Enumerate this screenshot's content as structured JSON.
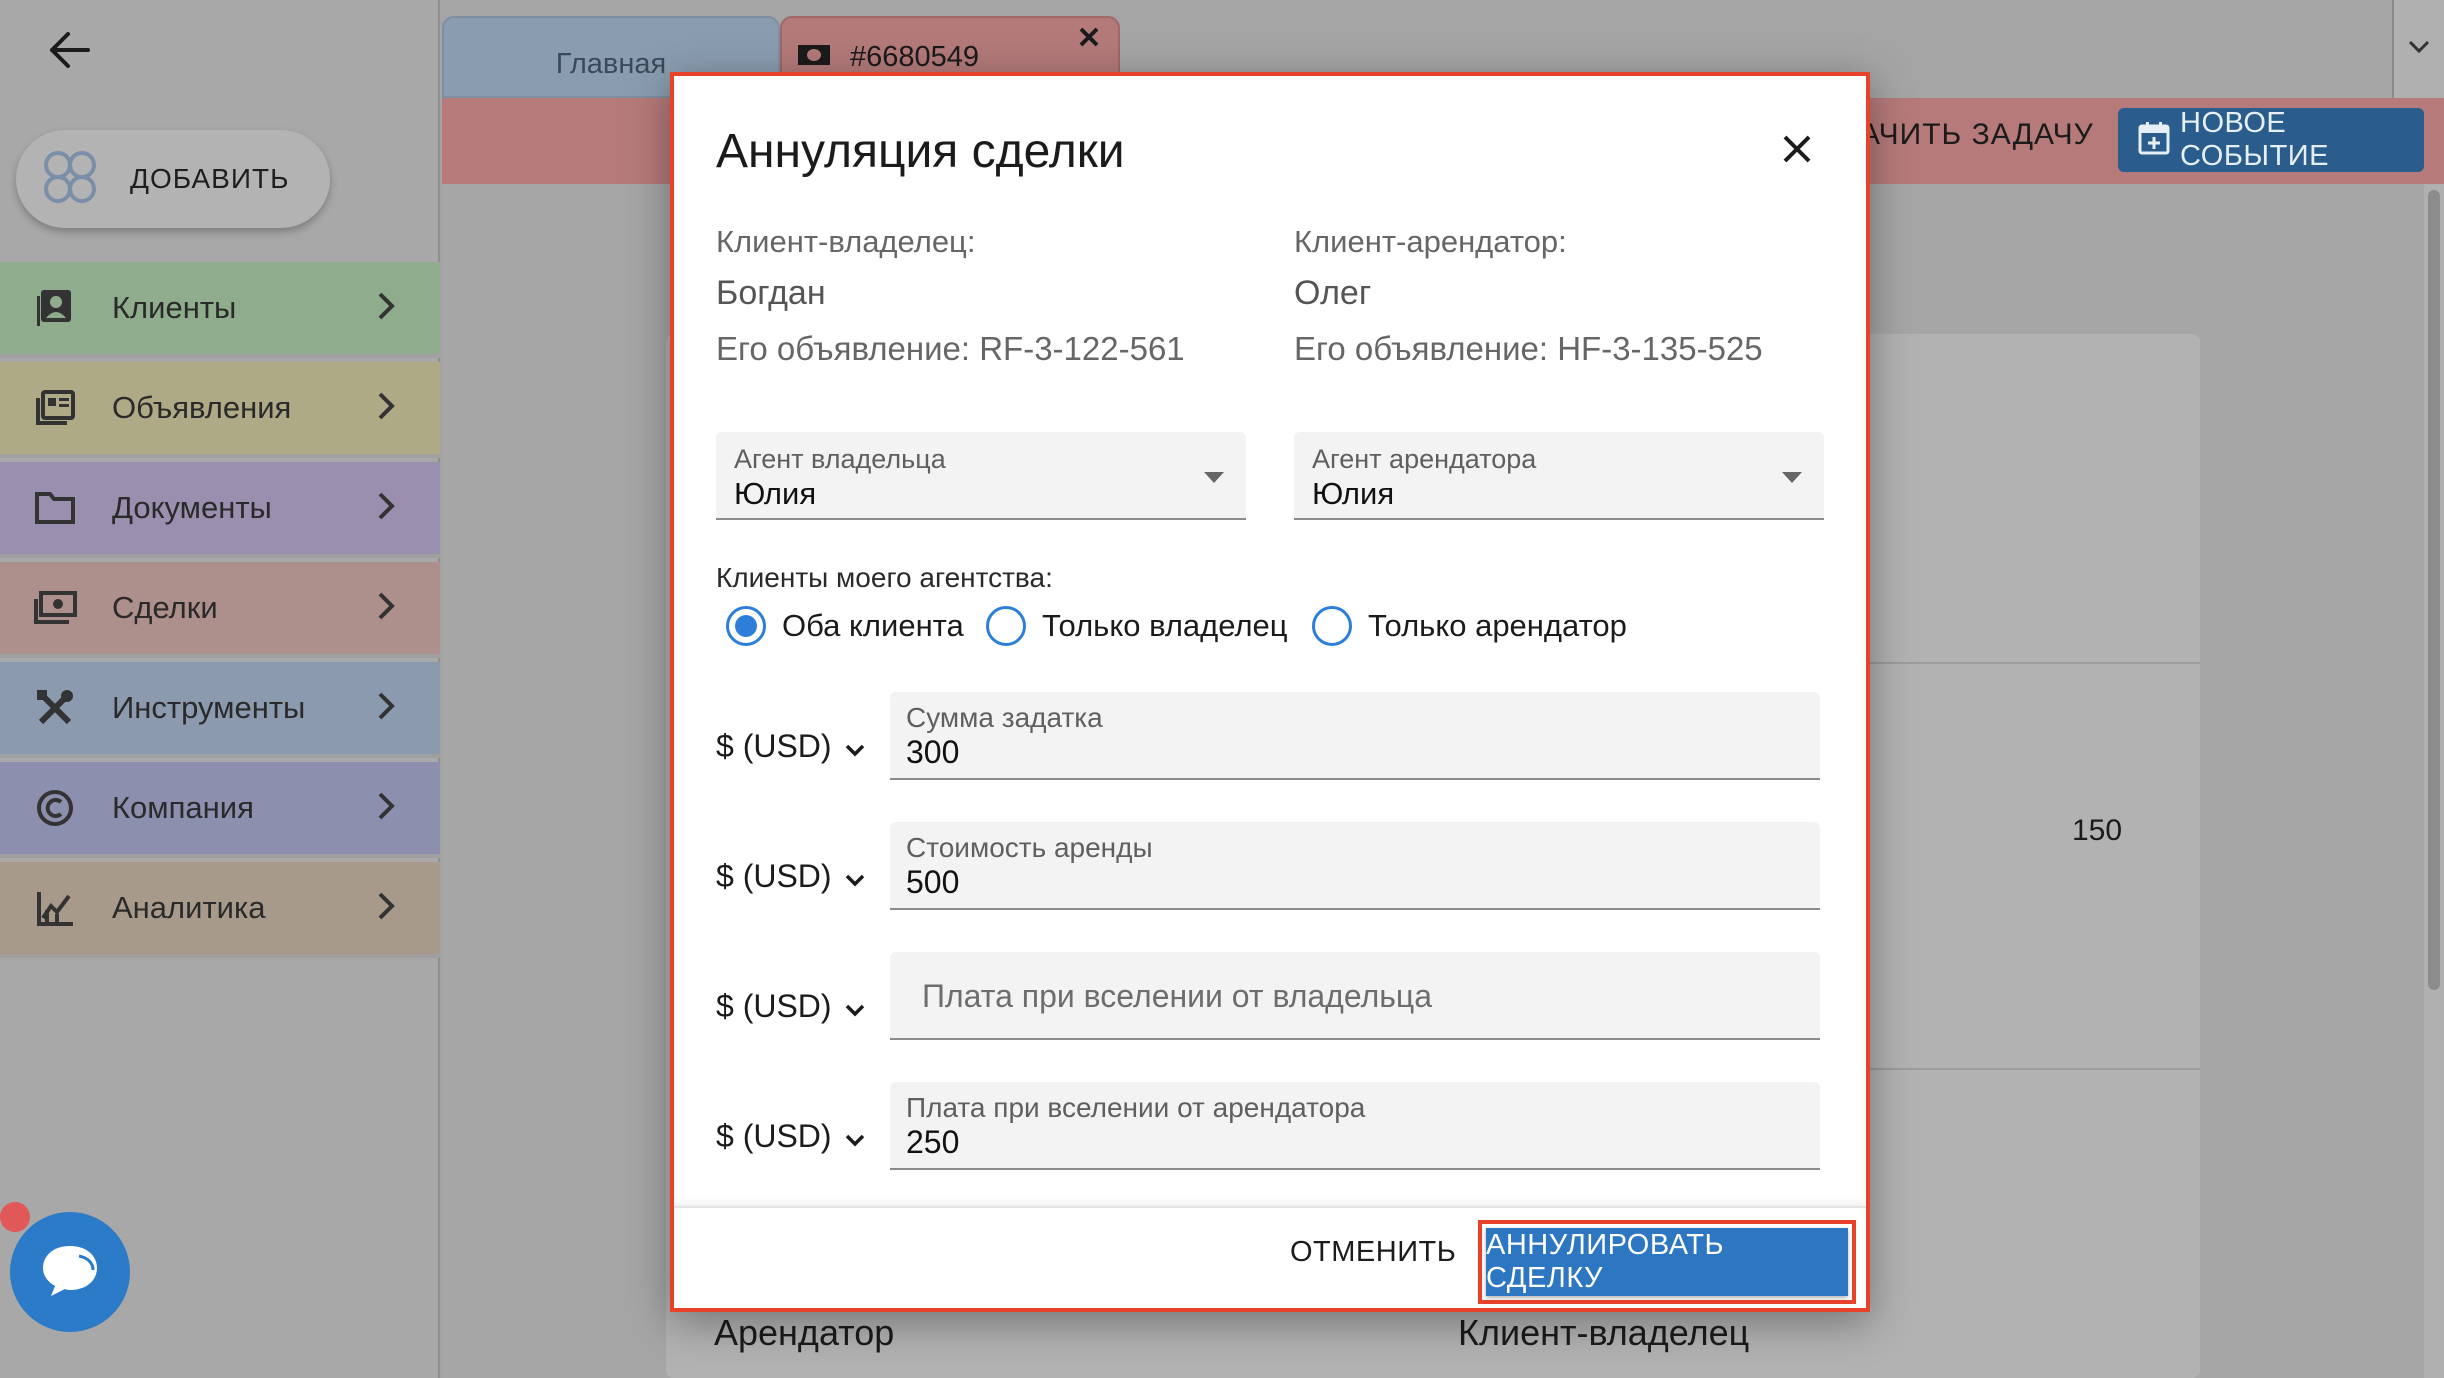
{
  "sidebar": {
    "add_label": "ДОБАВИТЬ",
    "items": [
      {
        "label": "Клиенты",
        "icon": "contacts-icon",
        "color": "#8fad8c"
      },
      {
        "label": "Объявления",
        "icon": "listings-icon",
        "color": "#adaa85"
      },
      {
        "label": "Документы",
        "icon": "folder-icon",
        "color": "#9a8fae"
      },
      {
        "label": "Сделки",
        "icon": "money-icon",
        "color": "#ad8f8c"
      },
      {
        "label": "Инструменты",
        "icon": "tools-icon",
        "color": "#8b9aae"
      },
      {
        "label": "Компания",
        "icon": "copyright-icon",
        "color": "#8d8fae"
      },
      {
        "label": "Аналитика",
        "icon": "analytics-icon",
        "color": "#a89a8a"
      }
    ]
  },
  "tabs": {
    "home": "Главная",
    "deal": "#6680549"
  },
  "toolbar": {
    "task_label": "АЧИТЬ ЗАДАЧУ",
    "new_event_label": "НОВОЕ СОБЫТИЕ"
  },
  "background": {
    "value": "150",
    "heading_left": "Арендатор",
    "heading_right": "Клиент-владелец"
  },
  "dialog": {
    "title": "Аннуляция сделки",
    "owner": {
      "caption": "Клиент-владелец:",
      "name": "Богдан",
      "listing": "Его объявление: RF-3-122-561"
    },
    "tenant": {
      "caption": "Клиент-арендатор:",
      "name": "Олег",
      "listing": "Его объявление: HF-3-135-525"
    },
    "owner_agent": {
      "label": "Агент владельца",
      "value": "Юлия"
    },
    "tenant_agent": {
      "label": "Агент арендатора",
      "value": "Юлия"
    },
    "clients_group": {
      "label": "Клиенты моего агентства:",
      "options": [
        "Оба клиента",
        "Только владелец",
        "Только арендатор"
      ],
      "selected": "Оба клиента"
    },
    "fields": [
      {
        "currency": "$ (USD)",
        "label": "Сумма задатка",
        "value": "300"
      },
      {
        "currency": "$ (USD)",
        "label": "Стоимость аренды",
        "value": "500"
      },
      {
        "currency": "$ (USD)",
        "placeholder": "Плата при вселении от владельца",
        "value": ""
      },
      {
        "currency": "$ (USD)",
        "label": "Плата при вселении от арендатора",
        "value": "250"
      }
    ],
    "cancel_label": "ОТМЕНИТЬ",
    "confirm_label": "АННУЛИРОВАТЬ СДЕЛКУ"
  },
  "colors": {
    "accent": "#2d76c2",
    "highlight": "#e8432a",
    "deal_tab": "#b47a7a",
    "home_tab": "#8a9db0"
  }
}
